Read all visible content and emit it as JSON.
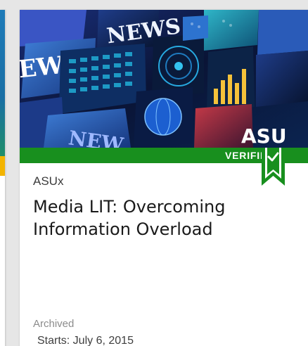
{
  "course": {
    "badge": "VERIFIED",
    "org": "ASUx",
    "title": "Media LIT: Overcoming Information Overload",
    "status": "Archived",
    "starts": "Starts: July 6, 2015",
    "image_text": {
      "news_1": "NEWS",
      "news_2": "EWS",
      "news_3": "NEW",
      "logo": "ASU"
    }
  },
  "colors": {
    "verified_green": "#188f1e",
    "previous_card_band": "#f3b400"
  }
}
